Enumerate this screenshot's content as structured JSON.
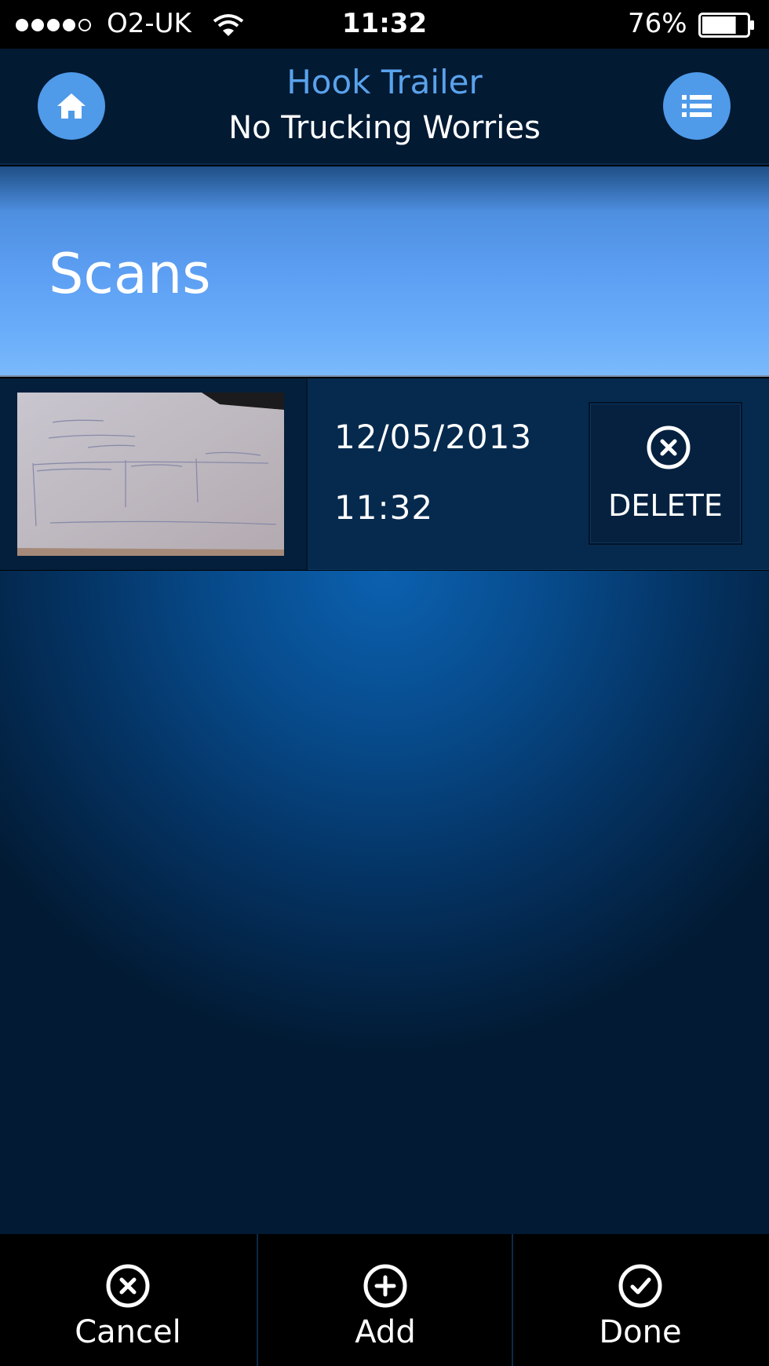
{
  "status_bar": {
    "carrier": "O2-UK",
    "time": "11:32",
    "battery_percent": "76%",
    "battery_level": 0.76,
    "signal_bars": 4,
    "signal_max": 5
  },
  "header": {
    "title": "Hook Trailer",
    "subtitle": "No Trucking Worries",
    "home_icon": "home-icon",
    "menu_icon": "list-icon"
  },
  "scans": {
    "title": "Scans",
    "items": [
      {
        "date": "12/05/2013",
        "time": "11:32",
        "delete_label": "DELETE"
      }
    ]
  },
  "toolbar": {
    "cancel_label": "Cancel",
    "add_label": "Add",
    "done_label": "Done"
  },
  "colors": {
    "accent": "#5aa2ec",
    "header_bg": "#031a33",
    "banner_blue": "#5c9ef2"
  }
}
